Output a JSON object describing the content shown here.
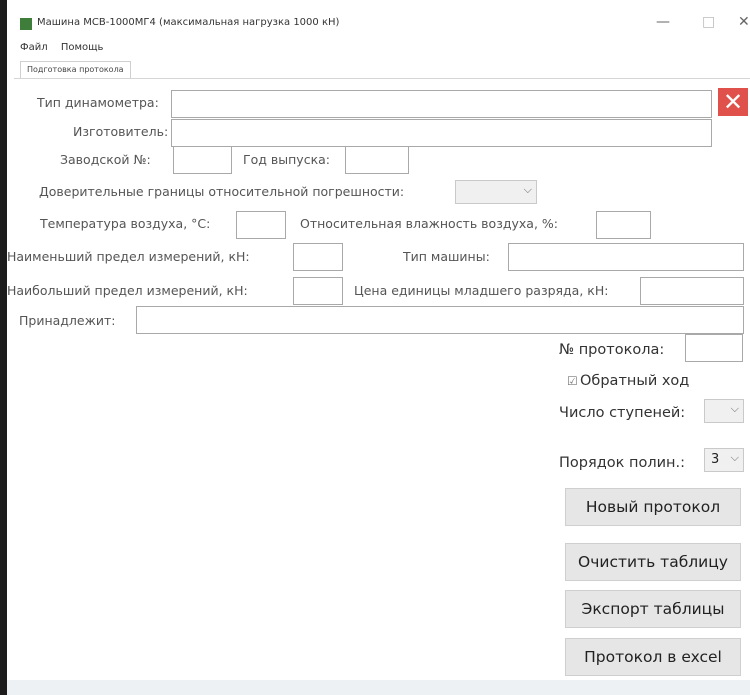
{
  "window": {
    "title": "Машина МСВ-1000МГ4 (максимальная нагрузка 1000 кН)",
    "minimize": "—",
    "maximize": "□",
    "close": "✕"
  },
  "menu": [
    "Файл",
    "Помощь"
  ],
  "tab": "Подготовка протокола",
  "form": {
    "dynamometer_type": "Тип динамометра:",
    "manufacturer": "Изготовитель:",
    "serial_no": "Заводской №:",
    "year": "Год выпуска:",
    "confidence_bounds": "Доверительные границы относительной погрешности:",
    "air_temp": "Температура воздуха, °С:",
    "humidity": "Относительная влажность воздуха, %:",
    "min_limit": "Наименьший предел измерений, кН:",
    "machine_type": "Тип машины:",
    "max_limit": "Наибольший предел измерений, кН:",
    "unit_price": "Цена единицы младшего разряда, кН:",
    "belongs_to": "Принадлежит:"
  },
  "side": {
    "protocol_no": "№ протокола:",
    "reverse_stroke": "Обратный ход",
    "steps_count": "Число ступеней:",
    "poly_order": "Порядок полин.:",
    "poly_order_value": "3"
  },
  "buttons": {
    "new_protocol": "Новый протокол",
    "clear_table": "Очистить таблицу",
    "export_table": "Экспорт таблицы",
    "protocol_excel": "Протокол в excel",
    "close_x": "✕"
  }
}
